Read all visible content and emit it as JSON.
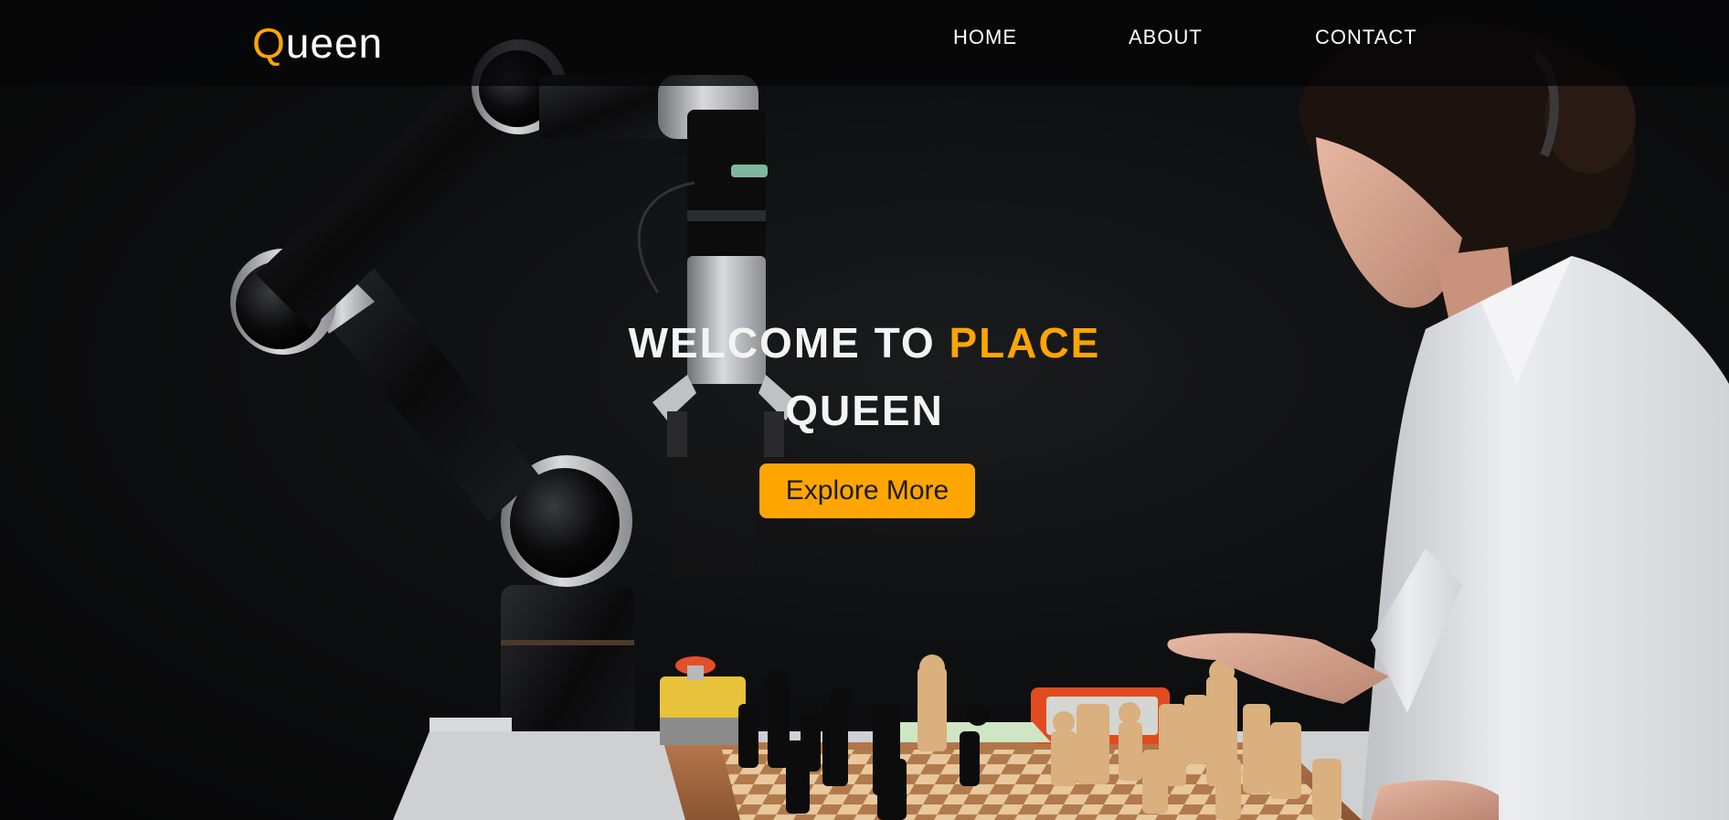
{
  "brand": {
    "logo_first_letter": "Q",
    "logo_rest": "ueen"
  },
  "nav": {
    "items": [
      {
        "label": "HOME"
      },
      {
        "label": "ABOUT"
      },
      {
        "label": "CONTACT"
      }
    ]
  },
  "hero": {
    "headline_part1": "WELCOME TO ",
    "headline_accent": "PLACE",
    "headline_line2": "QUEEN",
    "cta_label": "Explore More",
    "image_subject": "robotic arm playing chess against a woman"
  },
  "colors": {
    "accent": "#ffa500",
    "nav_bg": "#060607",
    "text": "#ffffff"
  }
}
